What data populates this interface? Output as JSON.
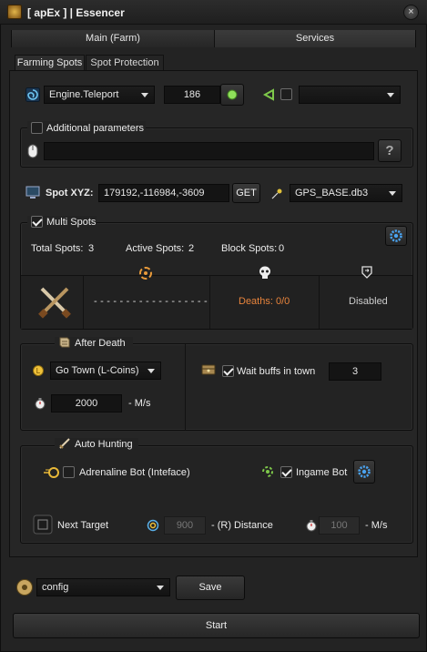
{
  "window": {
    "title": "[ apEx ] | Essencer",
    "close_glyph": "×"
  },
  "top_tabs": [
    {
      "label": "Main (Farm)"
    },
    {
      "label": "Services"
    }
  ],
  "sub_tabs": [
    {
      "label": "Farming Spots"
    },
    {
      "label": "Spot Protection"
    }
  ],
  "teleport": {
    "mode": "Engine.Teleport",
    "value": "186",
    "secondary_select": ""
  },
  "additional": {
    "label": "Additional parameters",
    "value": "",
    "help": "?"
  },
  "spot": {
    "label": "Spot XYZ:",
    "coords": "179192,-116984,-3609",
    "get_label": "GET",
    "db": "GPS_BASE.db3"
  },
  "multi": {
    "label": "Multi Spots",
    "total_label": "Total Spots:",
    "total": "3",
    "active_label": "Active Spots:",
    "active": "2",
    "block_label": "Block Spots:",
    "block": "0",
    "dashes": "- - - - - - - - - - - - - - - - - -",
    "deaths": "Deaths: 0/0",
    "disabled": "Disabled"
  },
  "after_death": {
    "label": "After Death",
    "option": "Go Town (L-Coins)",
    "delay": "2000",
    "delay_unit": "- M/s",
    "wait_label": "Wait buffs in town",
    "wait_value": "3"
  },
  "auto_hunting": {
    "label": "Auto Hunting",
    "adrenaline_label": "Adrenaline Bot (Inteface)",
    "ingame_label": "Ingame Bot",
    "next_target_label": "Next Target",
    "distance": "900",
    "distance_unit": "- (R) Distance",
    "speed": "100",
    "speed_unit": "- M/s"
  },
  "footer": {
    "config": "config",
    "save_label": "Save",
    "start_label": "Start"
  },
  "colors": {
    "accent_orange": "#e8843c",
    "accent_green": "#7ec84a",
    "gear_blue": "#3b8fd8"
  }
}
